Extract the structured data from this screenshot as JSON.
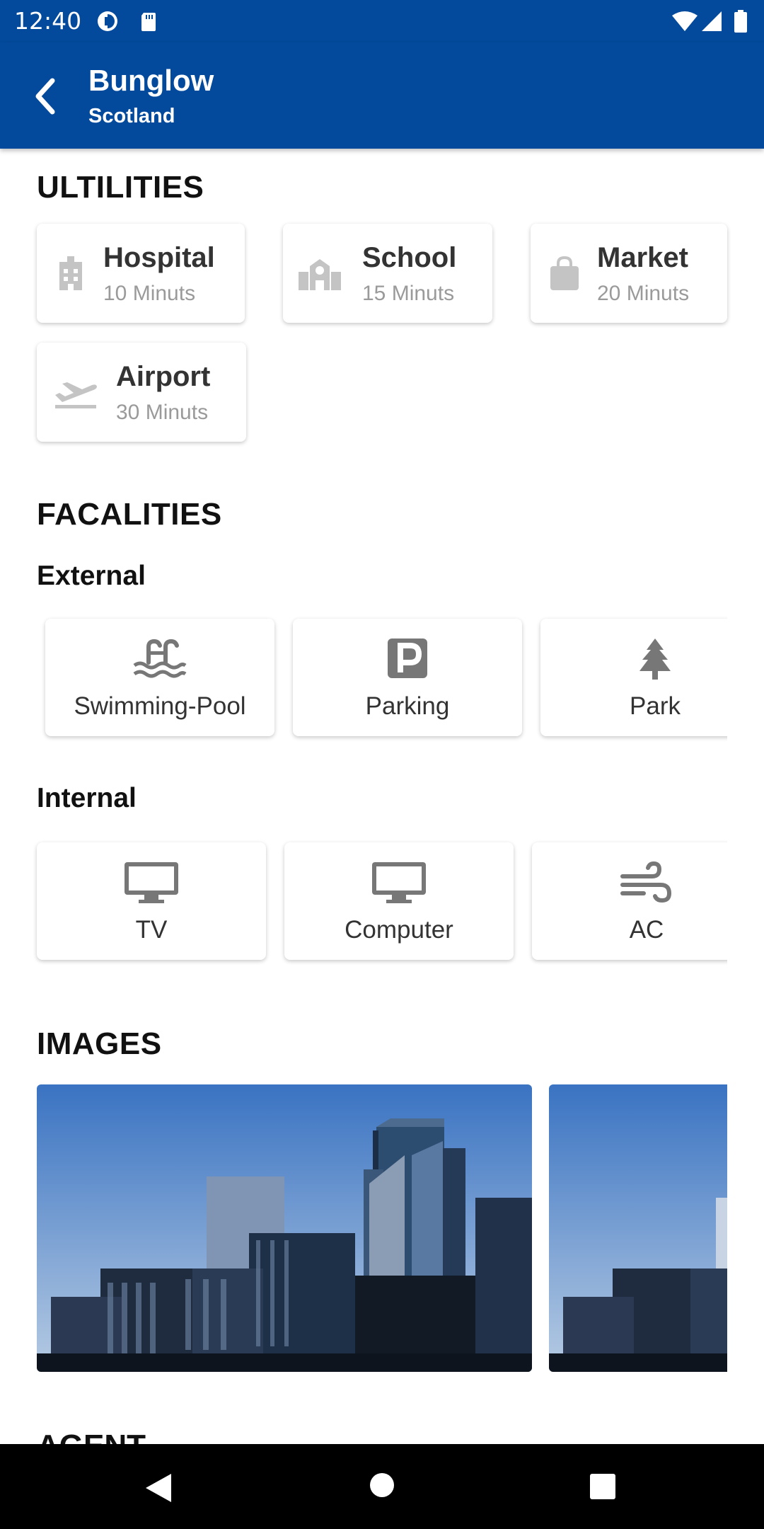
{
  "status_bar": {
    "time": "12:40"
  },
  "app_bar": {
    "title": "Bunglow",
    "subtitle": "Scotland"
  },
  "utilities": {
    "heading": "ULTILITIES",
    "items": [
      {
        "name": "Hospital",
        "time": "10 Minuts",
        "icon": "hospital-icon"
      },
      {
        "name": "School",
        "time": "15 Minuts",
        "icon": "school-icon"
      },
      {
        "name": "Market",
        "time": "20 Minuts",
        "icon": "shopping-bag-icon"
      },
      {
        "name": "Airport",
        "time": "30 Minuts",
        "icon": "plane-takeoff-icon"
      }
    ]
  },
  "facilities": {
    "heading": "FACALITIES",
    "external": {
      "label": "External",
      "items": [
        {
          "name": "Swimming-Pool",
          "icon": "pool-icon"
        },
        {
          "name": "Parking",
          "icon": "parking-icon"
        },
        {
          "name": "Park",
          "icon": "tree-icon"
        }
      ]
    },
    "internal": {
      "label": "Internal",
      "items": [
        {
          "name": "TV",
          "icon": "monitor-icon"
        },
        {
          "name": "Computer",
          "icon": "monitor-icon"
        },
        {
          "name": "AC",
          "icon": "wind-icon"
        }
      ]
    }
  },
  "images": {
    "heading": "IMAGES"
  },
  "agent": {
    "heading": "AGENT"
  },
  "colors": {
    "primary": "#034A9C",
    "icon_gray": "#777777",
    "muted_text": "#9a9a9a"
  }
}
